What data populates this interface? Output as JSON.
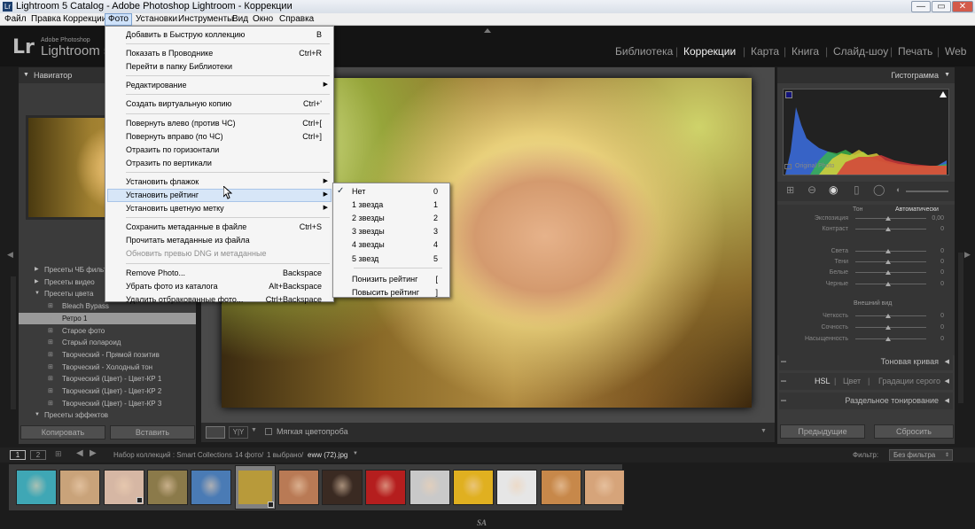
{
  "window": {
    "title": "Lightroom 5 Catalog - Adobe Photoshop Lightroom - Коррекции"
  },
  "menubar": {
    "items": [
      "Файл",
      "Правка",
      "Коррекции",
      "Фото",
      "Установки",
      "Инструменты",
      "Вид",
      "Окно",
      "Справка"
    ],
    "active_index": 3
  },
  "identity": {
    "logo": "Lr",
    "brand_small": "Adobe Photoshop",
    "brand": "Lightroom 5"
  },
  "modules": {
    "items": [
      "Библиотека",
      "Коррекции",
      "Карта",
      "Книга",
      "Слайд-шоу",
      "Печать",
      "Web"
    ],
    "active": "Коррекции"
  },
  "photo_menu": {
    "items": [
      {
        "label": "Добавить в Быструю коллекцию",
        "shortcut": "B"
      },
      {
        "sep": true
      },
      {
        "label": "Показать в Проводнике",
        "shortcut": "Ctrl+R"
      },
      {
        "label": "Перейти в папку Библиотеки",
        "shortcut": ""
      },
      {
        "sep": true
      },
      {
        "label": "Редактирование",
        "shortcut": "",
        "submenu": true
      },
      {
        "sep": true
      },
      {
        "label": "Создать виртуальную копию",
        "shortcut": "Ctrl+'"
      },
      {
        "sep": true
      },
      {
        "label": "Повернуть влево (против ЧС)",
        "shortcut": "Ctrl+["
      },
      {
        "label": "Повернуть вправо (по ЧС)",
        "shortcut": "Ctrl+]"
      },
      {
        "label": "Отразить по горизонтали",
        "shortcut": ""
      },
      {
        "label": "Отразить по вертикали",
        "shortcut": ""
      },
      {
        "sep": true
      },
      {
        "label": "Установить флажок",
        "shortcut": "",
        "submenu": true
      },
      {
        "label": "Установить рейтинг",
        "shortcut": "",
        "submenu": true,
        "highlighted": true
      },
      {
        "label": "Установить цветную метку",
        "shortcut": "",
        "submenu": true
      },
      {
        "sep": true
      },
      {
        "label": "Сохранить метаданные в файле",
        "shortcut": "Ctrl+S"
      },
      {
        "label": "Прочитать метаданные из файла",
        "shortcut": ""
      },
      {
        "label": "Обновить превью DNG и метаданные",
        "shortcut": "",
        "disabled": true
      },
      {
        "sep": true
      },
      {
        "label": "Remove Photo...",
        "shortcut": "Backspace"
      },
      {
        "label": "Убрать фото из каталога",
        "shortcut": "Alt+Backspace"
      },
      {
        "label": "Удалить отбракованные фото...",
        "shortcut": "Ctrl+Backspace"
      }
    ]
  },
  "rating_menu": {
    "items": [
      {
        "label": "Нет",
        "shortcut": "0",
        "checked": true
      },
      {
        "label": "1 звезда",
        "shortcut": "1"
      },
      {
        "label": "2 звезды",
        "shortcut": "2"
      },
      {
        "label": "3 звезды",
        "shortcut": "3"
      },
      {
        "label": "4 звезды",
        "shortcut": "4"
      },
      {
        "label": "5 звезд",
        "shortcut": "5"
      },
      {
        "sep": true
      },
      {
        "label": "Понизить рейтинг",
        "shortcut": "["
      },
      {
        "label": "Повысить рейтинг",
        "shortcut": "]"
      }
    ]
  },
  "left_panel": {
    "navigator_title": "Навигатор",
    "presets": [
      {
        "label": "Пресеты ЧБ фильтр",
        "kind": "folder",
        "expanded": false
      },
      {
        "label": "Пресеты видео",
        "kind": "folder",
        "expanded": false
      },
      {
        "label": "Пресеты цвета",
        "kind": "folder",
        "expanded": true
      },
      {
        "label": "Bleach Bypass",
        "kind": "item"
      },
      {
        "label": "Ретро 1",
        "kind": "item",
        "selected": true
      },
      {
        "label": "Старое фото",
        "kind": "item"
      },
      {
        "label": "Старый полароид",
        "kind": "item"
      },
      {
        "label": "Творческий - Прямой позитив",
        "kind": "item"
      },
      {
        "label": "Творческий - Холодный тон",
        "kind": "item"
      },
      {
        "label": "Творческий (Цвет) - Цвет-КР 1",
        "kind": "item"
      },
      {
        "label": "Творческий (Цвет) - Цвет-КР 2",
        "kind": "item"
      },
      {
        "label": "Творческий (Цвет) - Цвет-КР 3",
        "kind": "item"
      },
      {
        "label": "Пресеты эффектов",
        "kind": "folder",
        "expanded": true
      }
    ],
    "copy_button": "Копировать",
    "paste_button": "Вставить"
  },
  "right_panel": {
    "histogram_title": "Гистограмма",
    "original_photo": "Original Photo",
    "tone_label": "Тон",
    "auto_label": "Автоматически",
    "sliders": [
      {
        "label": "Экспозиция",
        "value": "0,00"
      },
      {
        "label": "Контраст",
        "value": "0"
      },
      {
        "label": "Света",
        "value": "0"
      },
      {
        "label": "Тени",
        "value": "0"
      },
      {
        "label": "Белые",
        "value": "0"
      },
      {
        "label": "Черные",
        "value": "0"
      },
      {
        "label": "Четкость",
        "value": "0"
      },
      {
        "label": "Сочность",
        "value": "0"
      },
      {
        "label": "Насыщенность",
        "value": "0"
      }
    ],
    "presence_label": "Внешний вид",
    "tone_curve": "Тоновая кривая",
    "hsl_tabs": [
      "HSL",
      "Цвет",
      "Градации серого"
    ],
    "split_toning": "Раздельное тонирование",
    "prev_button": "Предыдущие",
    "reset_button": "Сбросить"
  },
  "toolbar": {
    "soft_proof": "Мягкая цветопроба",
    "view_yy": "Y|Y"
  },
  "filmstrip_bar": {
    "page1": "1",
    "page2": "2",
    "path": "Набор коллекций : Smart Collections",
    "count": "14 фото/",
    "selected": "1 выбрано/",
    "filename": "eww (72).jpg",
    "filter_label": "Фильтр:",
    "filter_value": "Без фильтра"
  },
  "filmstrip": {
    "thumbs": [
      {
        "color": "#3fa7b5",
        "badge": false
      },
      {
        "color": "#c9a37a",
        "badge": false
      },
      {
        "color": "#d6b7a4",
        "badge": true
      },
      {
        "color": "#8b7a4a",
        "badge": false
      },
      {
        "color": "#4a7bb5",
        "badge": false
      },
      {
        "color": "#b89a3a",
        "badge": true,
        "selected": true
      },
      {
        "color": "#b97a55",
        "badge": false
      },
      {
        "color": "#3a2a22",
        "badge": false
      },
      {
        "color": "#b51e1e",
        "badge": false
      },
      {
        "color": "#c9c9c9",
        "badge": false
      },
      {
        "color": "#e0b020",
        "badge": false
      },
      {
        "color": "#e6e6e6",
        "badge": false
      },
      {
        "color": "#c7884a",
        "badge": false
      },
      {
        "color": "#d6a47a",
        "badge": false
      }
    ]
  },
  "watermark": "SA"
}
